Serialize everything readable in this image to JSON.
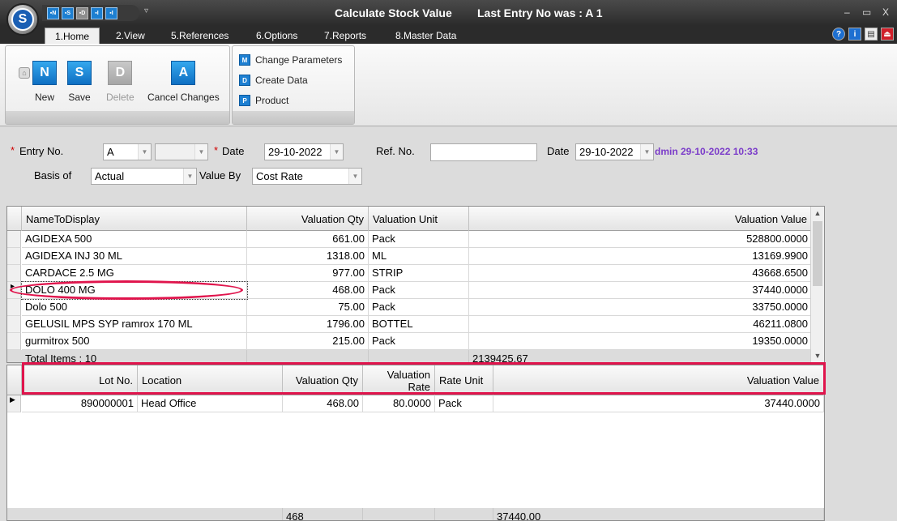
{
  "window": {
    "title": "Calculate Stock Value",
    "last_entry": "Last Entry No was : A 1",
    "controls": [
      "–",
      "▭",
      "X"
    ]
  },
  "tabs": [
    "1.Home",
    "2.View",
    "5.References",
    "6.Options",
    "7.Reports",
    "8.Master Data"
  ],
  "ribbon": {
    "new_label": "New",
    "save_label": "Save",
    "delete_label": "Delete",
    "cancel_label": "Cancel Changes",
    "change_params_label": "Change Parameters",
    "create_data_label": "Create Data",
    "product_label": "Product"
  },
  "form": {
    "entry_no_label": "Entry No.",
    "entry_no_value": "A",
    "date_label": "Date",
    "date_value": "29-10-2022",
    "ref_no_label": "Ref. No.",
    "ref_no_value": "",
    "ref_date_label": "Date",
    "ref_date_value": "29-10-2022",
    "user_stamp": "dmin 29-10-2022 10:33",
    "basis_label": "Basis of",
    "basis_value": "Actual",
    "value_by_label": "Value By",
    "value_by_value": "Cost Rate",
    "required_marker": "*"
  },
  "main_grid": {
    "columns": [
      "NameToDisplay",
      "Valuation Qty",
      "Valuation Unit",
      "Valuation Value"
    ],
    "rows": [
      {
        "name": "AGIDEXA 500",
        "qty": "661.00",
        "unit": "Pack",
        "value": "528800.0000"
      },
      {
        "name": "AGIDEXA INJ 30 ML",
        "qty": "1318.00",
        "unit": "ML",
        "value": "13169.9900"
      },
      {
        "name": "CARDACE 2.5 MG",
        "qty": "977.00",
        "unit": "STRIP",
        "value": "43668.6500"
      },
      {
        "name": "DOLO 400 MG",
        "qty": "468.00",
        "unit": "Pack",
        "value": "37440.0000"
      },
      {
        "name": "Dolo 500",
        "qty": "75.00",
        "unit": "Pack",
        "value": "33750.0000"
      },
      {
        "name": "GELUSIL MPS SYP ramrox 170 ML",
        "qty": "1796.00",
        "unit": "BOTTEL",
        "value": "46211.0800"
      },
      {
        "name": "gurmitrox 500",
        "qty": "215.00",
        "unit": "Pack",
        "value": "19350.0000"
      }
    ],
    "total_items": "Total Items : 10",
    "total_value": "2139425.67"
  },
  "lot_grid": {
    "columns": [
      "Lot No.",
      "Location",
      "Valuation Qty",
      "Valuation Rate",
      "Rate Unit",
      "Valuation Value"
    ],
    "rows": [
      {
        "lot": "890000001",
        "location": "Head Office",
        "qty": "468.00",
        "rate": "80.0000",
        "unit": "Pack",
        "value": "37440.0000"
      }
    ],
    "footer_qty": "468",
    "footer_value": "37440.00"
  }
}
